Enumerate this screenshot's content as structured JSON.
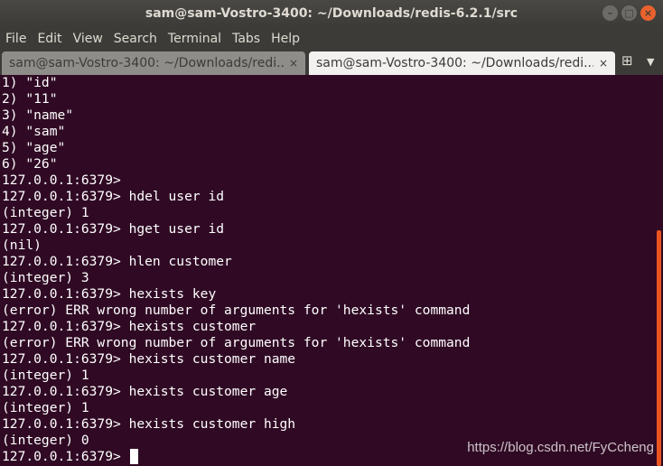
{
  "window": {
    "title": "sam@sam-Vostro-3400: ~/Downloads/redis-6.2.1/src",
    "controls": {
      "minimize": "–",
      "maximize": "□",
      "close": "×"
    }
  },
  "menubar": {
    "items": [
      "File",
      "Edit",
      "View",
      "Search",
      "Terminal",
      "Tabs",
      "Help"
    ]
  },
  "tabs": [
    {
      "label": "sam@sam-Vostro-3400: ~/Downloads/redi...",
      "close": "×",
      "active": false
    },
    {
      "label": "sam@sam-Vostro-3400: ~/Downloads/redi...",
      "close": "×",
      "active": true
    }
  ],
  "tabbar": {
    "new_tab_glyph": "⊞",
    "menu_glyph": "▼"
  },
  "terminal": {
    "lines": [
      "1) \"id\"",
      "2) \"11\"",
      "3) \"name\"",
      "4) \"sam\"",
      "5) \"age\"",
      "6) \"26\"",
      "127.0.0.1:6379>",
      "127.0.0.1:6379> hdel user id",
      "(integer) 1",
      "127.0.0.1:6379> hget user id",
      "(nil)",
      "127.0.0.1:6379> hlen customer",
      "(integer) 3",
      "127.0.0.1:6379> hexists key",
      "(error) ERR wrong number of arguments for 'hexists' command",
      "127.0.0.1:6379> hexists customer",
      "(error) ERR wrong number of arguments for 'hexists' command",
      "127.0.0.1:6379> hexists customer name",
      "(integer) 1",
      "127.0.0.1:6379> hexists customer age",
      "(integer) 1",
      "127.0.0.1:6379> hexists customer high",
      "(integer) 0"
    ],
    "prompt": "127.0.0.1:6379> "
  },
  "watermark": "https://blog.csdn.net/FyCcheng",
  "colors": {
    "terminal_bg": "#300a24",
    "scrollbar": "#e95420",
    "close_button": "#e9622d"
  }
}
